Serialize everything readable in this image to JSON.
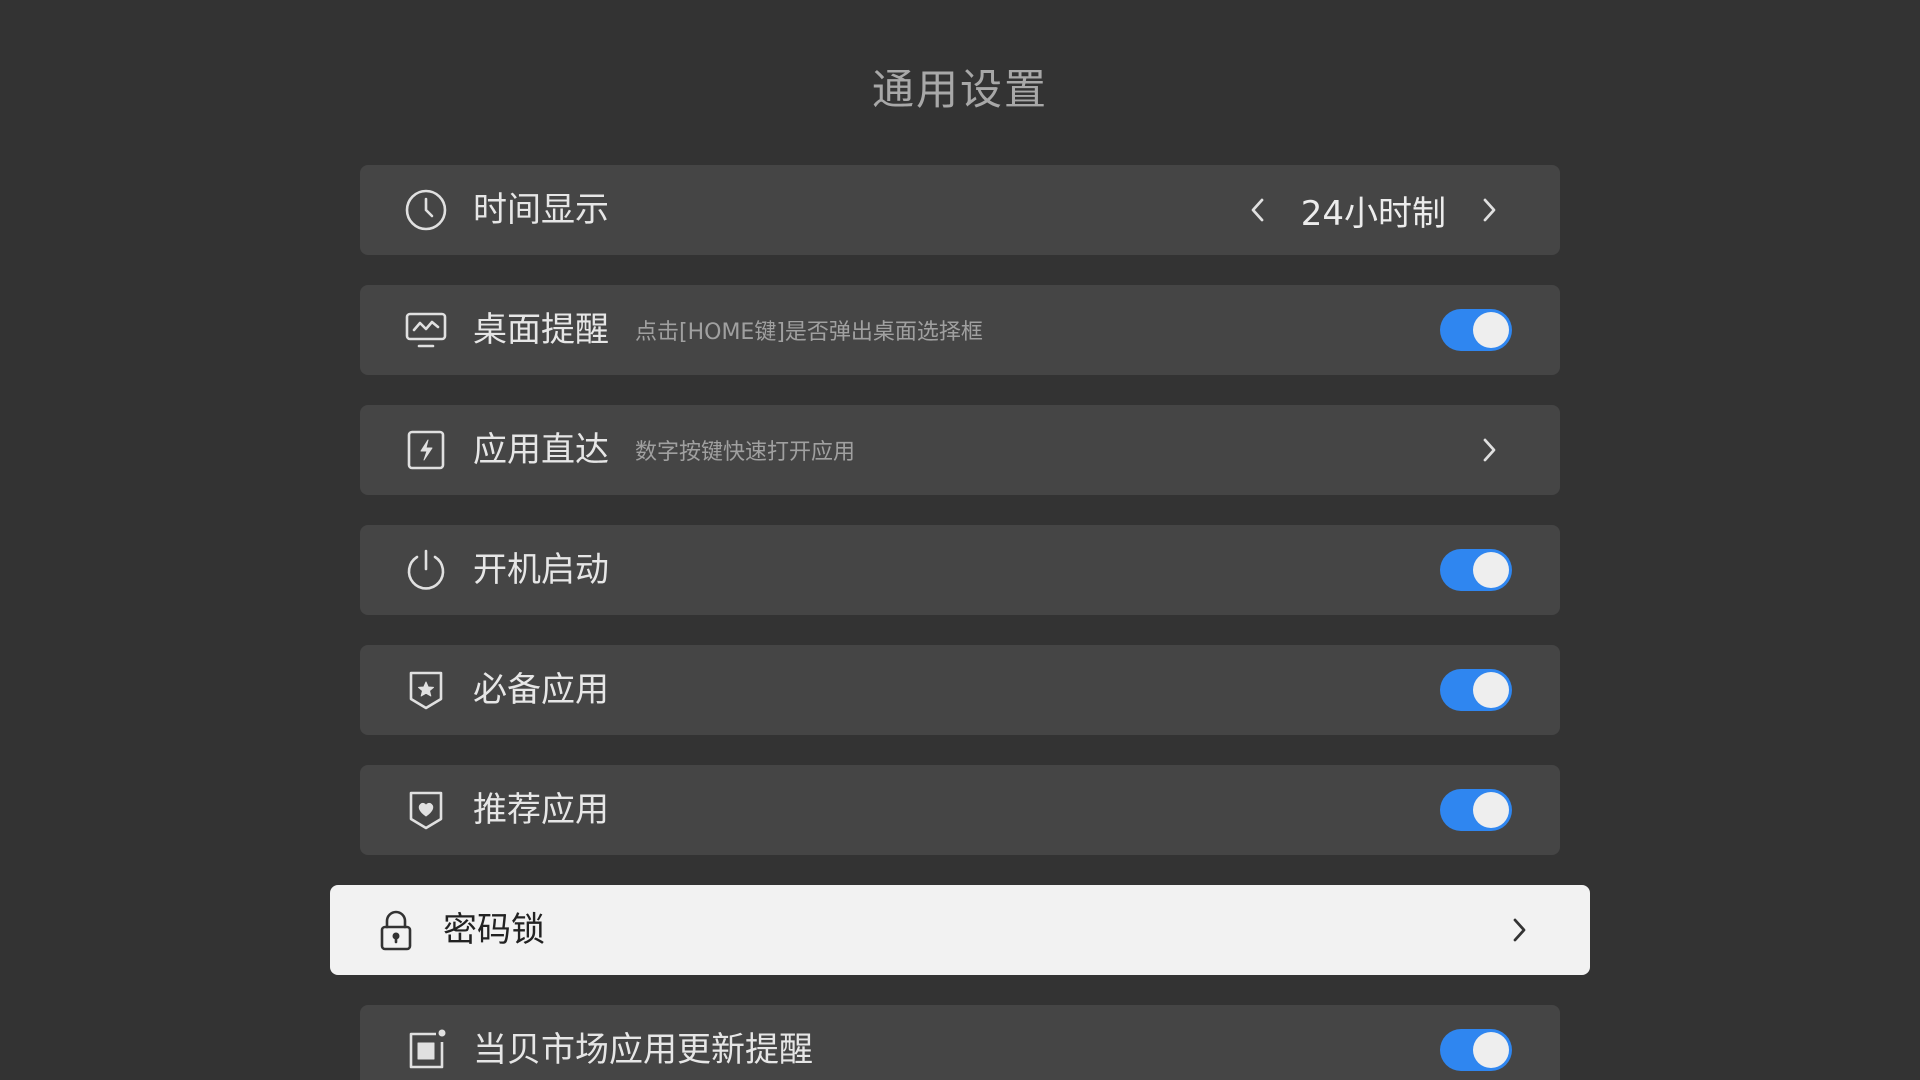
{
  "page": {
    "title": "通用设置"
  },
  "settings": {
    "time_display": {
      "label": "时间显示",
      "value": "24小时制",
      "icon": "clock-icon"
    },
    "desktop_reminder": {
      "label": "桌面提醒",
      "description": "点击[HOME键]是否弹出桌面选择框",
      "enabled": true,
      "icon": "monitor-icon"
    },
    "app_direct": {
      "label": "应用直达",
      "description": "数字按键快速打开应用",
      "icon": "lightning-box-icon"
    },
    "boot_start": {
      "label": "开机启动",
      "enabled": true,
      "icon": "power-icon"
    },
    "essential_apps": {
      "label": "必备应用",
      "enabled": true,
      "icon": "star-shield-icon"
    },
    "recommended_apps": {
      "label": "推荐应用",
      "enabled": true,
      "icon": "heart-shield-icon"
    },
    "password_lock": {
      "label": "密码锁",
      "icon": "lock-icon",
      "focused": true
    },
    "market_update": {
      "label": "当贝市场应用更新提醒",
      "enabled": true,
      "icon": "app-badge-icon"
    }
  },
  "colors": {
    "background": "#333333",
    "row": "#454545",
    "row_focused": "#f2f2f2",
    "toggle_on": "#2f86f0"
  }
}
